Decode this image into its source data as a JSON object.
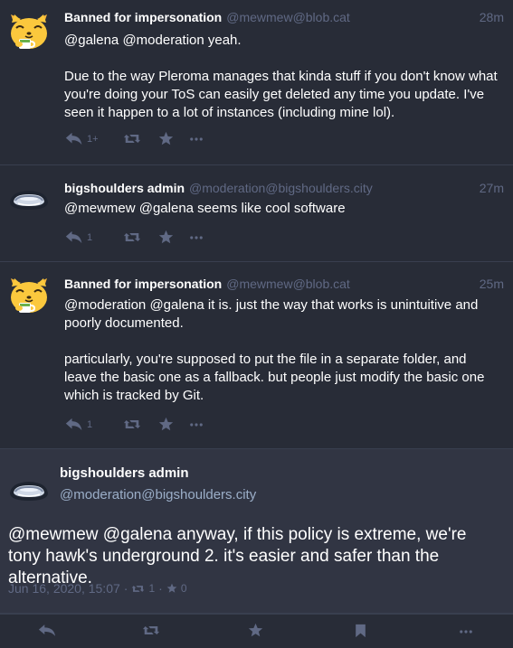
{
  "colors": {
    "background": "#282c37",
    "detailed_background": "#313543",
    "muted": "#606984",
    "text": "#ffffff",
    "divider": "#393f4f"
  },
  "statuses": [
    {
      "avatar": "blob-cat-avatar",
      "display_name": "Banned for impersonation",
      "acct": "@mewmew@blob.cat",
      "time": "28m",
      "content": [
        "@galena @moderation yeah.",
        "Due to the way Pleroma manages that kinda stuff if you don't know what you're doing your ToS can easily get deleted any time you update. I've seen it happen to a lot of instances (including mine lol)."
      ],
      "reply_count": "1+"
    },
    {
      "avatar": "shoulders-avatar",
      "display_name": "bigshoulders admin",
      "acct": "@moderation@bigshoulders.city",
      "time": "27m",
      "content": [
        "@mewmew @galena seems like cool software"
      ],
      "reply_count": "1"
    },
    {
      "avatar": "blob-cat-avatar",
      "display_name": "Banned for impersonation",
      "acct": "@mewmew@blob.cat",
      "time": "25m",
      "content": [
        "@moderation @galena it is. just the way that works is unintuitive and poorly documented.",
        "particularly, you're supposed to put the file in a separate folder, and leave the basic one as a fallback. but people just modify the basic one which is tracked by Git."
      ],
      "reply_count": "1"
    }
  ],
  "detailed": {
    "display_name": "bigshoulders admin",
    "acct": "@moderation@bigshoulders.city",
    "content": "@mewmew @galena anyway, if this policy is extreme, we're tony hawk's underground 2. it's easier and safer than the alternative.",
    "date": "Jun 16, 2020, 15:07",
    "separator": "·",
    "boost_count": "1",
    "fav_count": "0"
  },
  "icons": {
    "reply": "reply-all-icon",
    "boost": "retweet-icon",
    "favourite": "star-icon",
    "more": "ellipsis-icon",
    "bookmark": "bookmark-icon"
  }
}
